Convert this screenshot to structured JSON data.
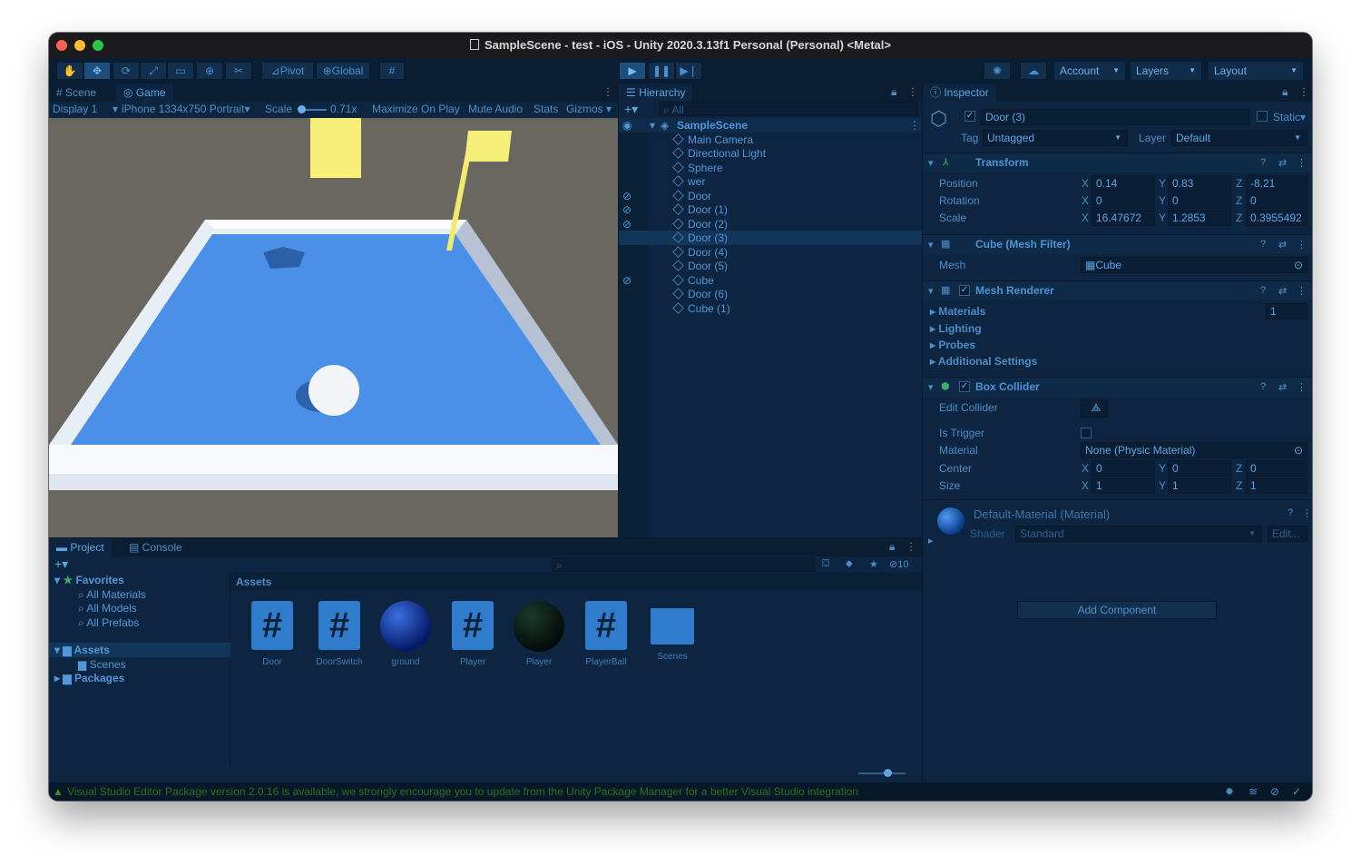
{
  "window": {
    "title": "SampleScene - test - iOS - Unity 2020.3.13f1 Personal (Personal) <Metal>"
  },
  "toolbar": {
    "pivot": "Pivot",
    "global": "Global",
    "account": "Account",
    "layers": "Layers",
    "layout": "Layout"
  },
  "game_view": {
    "tabs": [
      "Scene",
      "Game"
    ],
    "display": "Display 1",
    "resolution": "iPhone 1334x750 Portrait",
    "scale_label": "Scale",
    "scale_value": "0.71x",
    "maximize_on_play": "Maximize On Play",
    "mute_audio": "Mute Audio",
    "stats": "Stats",
    "gizmos": "Gizmos"
  },
  "hierarchy": {
    "title": "Hierarchy",
    "search_placeholder": "All",
    "scene": "SampleScene",
    "items": [
      "Main Camera",
      "Directional Light",
      "Sphere",
      "wer",
      "Door",
      "Door (1)",
      "Door (2)",
      "Door (3)",
      "Door (4)",
      "Door (5)",
      "Cube",
      "Door (6)",
      "Cube (1)"
    ],
    "selected": "Door (3)"
  },
  "inspector": {
    "title": "Inspector",
    "object_name": "Door (3)",
    "static_label": "Static",
    "tag_label": "Tag",
    "tag_value": "Untagged",
    "layer_label": "Layer",
    "layer_value": "Default",
    "transform": {
      "title": "Transform",
      "position_label": "Position",
      "rotation_label": "Rotation",
      "scale_label": "Scale",
      "position": [
        "0.14",
        "0.83",
        "-8.21"
      ],
      "rotation": [
        "0",
        "0",
        "0"
      ],
      "scale": [
        "16.47672",
        "1.2853",
        "0.3955492"
      ]
    },
    "mesh_filter": {
      "title": "Cube (Mesh Filter)",
      "mesh_label": "Mesh",
      "mesh_value": "Cube"
    },
    "mesh_renderer": {
      "title": "Mesh Renderer",
      "materials": "Materials",
      "materials_count": "1",
      "lighting": "Lighting",
      "probes": "Probes",
      "additional": "Additional Settings"
    },
    "box_collider": {
      "title": "Box Collider",
      "edit_collider": "Edit Collider",
      "is_trigger": "Is Trigger",
      "material_label": "Material",
      "material_value": "None (Physic Material)",
      "center_label": "Center",
      "size_label": "Size",
      "center": [
        "0",
        "0",
        "0"
      ],
      "size": [
        "1",
        "1",
        "1"
      ]
    },
    "material": {
      "title": "Default-Material (Material)",
      "shader_label": "Shader",
      "shader_value": "Standard",
      "edit": "Edit..."
    },
    "add_component": "Add Component",
    "axis": {
      "x": "X",
      "y": "Y",
      "z": "Z"
    }
  },
  "project": {
    "tabs": [
      "Project",
      "Console"
    ],
    "favorites": "Favorites",
    "favorite_items": [
      "All Materials",
      "All Models",
      "All Prefabs"
    ],
    "assets": "Assets",
    "scenes": "Scenes",
    "packages": "Packages",
    "assets_header": "Assets",
    "hidden_count": "10",
    "asset_items": [
      {
        "name": "Door",
        "kind": "script"
      },
      {
        "name": "DoorSwitch",
        "kind": "script"
      },
      {
        "name": "ground",
        "kind": "material-blue"
      },
      {
        "name": "Player",
        "kind": "script"
      },
      {
        "name": "Player",
        "kind": "material-dark"
      },
      {
        "name": "PlayerBall",
        "kind": "script"
      },
      {
        "name": "Scenes",
        "kind": "folder"
      }
    ]
  },
  "status": {
    "message": "Visual Studio Editor Package version 2.0.16 is available, we strongly encourage you to update from the Unity Package Manager for a better Visual Studio integration"
  },
  "colors": {
    "accent": "#2f7ccd",
    "background": "#0c2238",
    "game_floor": "#4a8fe8",
    "warning": "#2f6e20"
  }
}
